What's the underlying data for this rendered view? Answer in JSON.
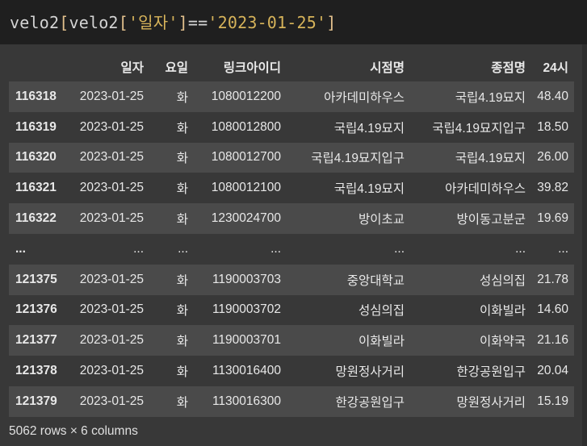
{
  "code": {
    "part1": "velo2",
    "part2": "[",
    "part3": "velo2",
    "part4": "[",
    "part5": "'일자'",
    "part6": "]",
    "part7": "==",
    "part8": "'2023-01-25'",
    "part9": "]"
  },
  "table": {
    "columns": [
      "",
      "일자",
      "요일",
      "링크아이디",
      "시점명",
      "종점명",
      "24시"
    ],
    "rows": [
      {
        "idx": "116318",
        "date": "2023-01-25",
        "day": "화",
        "link": "1080012200",
        "start": "아카데미하우스",
        "end": "국립4.19묘지",
        "val": "48.40"
      },
      {
        "idx": "116319",
        "date": "2023-01-25",
        "day": "화",
        "link": "1080012800",
        "start": "국립4.19묘지",
        "end": "국립4.19묘지입구",
        "val": "18.50"
      },
      {
        "idx": "116320",
        "date": "2023-01-25",
        "day": "화",
        "link": "1080012700",
        "start": "국립4.19묘지입구",
        "end": "국립4.19묘지",
        "val": "26.00"
      },
      {
        "idx": "116321",
        "date": "2023-01-25",
        "day": "화",
        "link": "1080012100",
        "start": "국립4.19묘지",
        "end": "아카데미하우스",
        "val": "39.82"
      },
      {
        "idx": "116322",
        "date": "2023-01-25",
        "day": "화",
        "link": "1230024700",
        "start": "방이초교",
        "end": "방이동고분군",
        "val": "19.69"
      },
      {
        "idx": "...",
        "date": "...",
        "day": "...",
        "link": "...",
        "start": "...",
        "end": "...",
        "val": "..."
      },
      {
        "idx": "121375",
        "date": "2023-01-25",
        "day": "화",
        "link": "1190003703",
        "start": "중앙대학교",
        "end": "성심의집",
        "val": "21.78"
      },
      {
        "idx": "121376",
        "date": "2023-01-25",
        "day": "화",
        "link": "1190003702",
        "start": "성심의집",
        "end": "이화빌라",
        "val": "14.60"
      },
      {
        "idx": "121377",
        "date": "2023-01-25",
        "day": "화",
        "link": "1190003701",
        "start": "이화빌라",
        "end": "이화약국",
        "val": "21.16"
      },
      {
        "idx": "121378",
        "date": "2023-01-25",
        "day": "화",
        "link": "1130016400",
        "start": "망원정사거리",
        "end": "한강공원입구",
        "val": "20.04"
      },
      {
        "idx": "121379",
        "date": "2023-01-25",
        "day": "화",
        "link": "1130016300",
        "start": "한강공원입구",
        "end": "망원정사거리",
        "val": "15.19"
      }
    ]
  },
  "footer": "5062 rows × 6 columns"
}
